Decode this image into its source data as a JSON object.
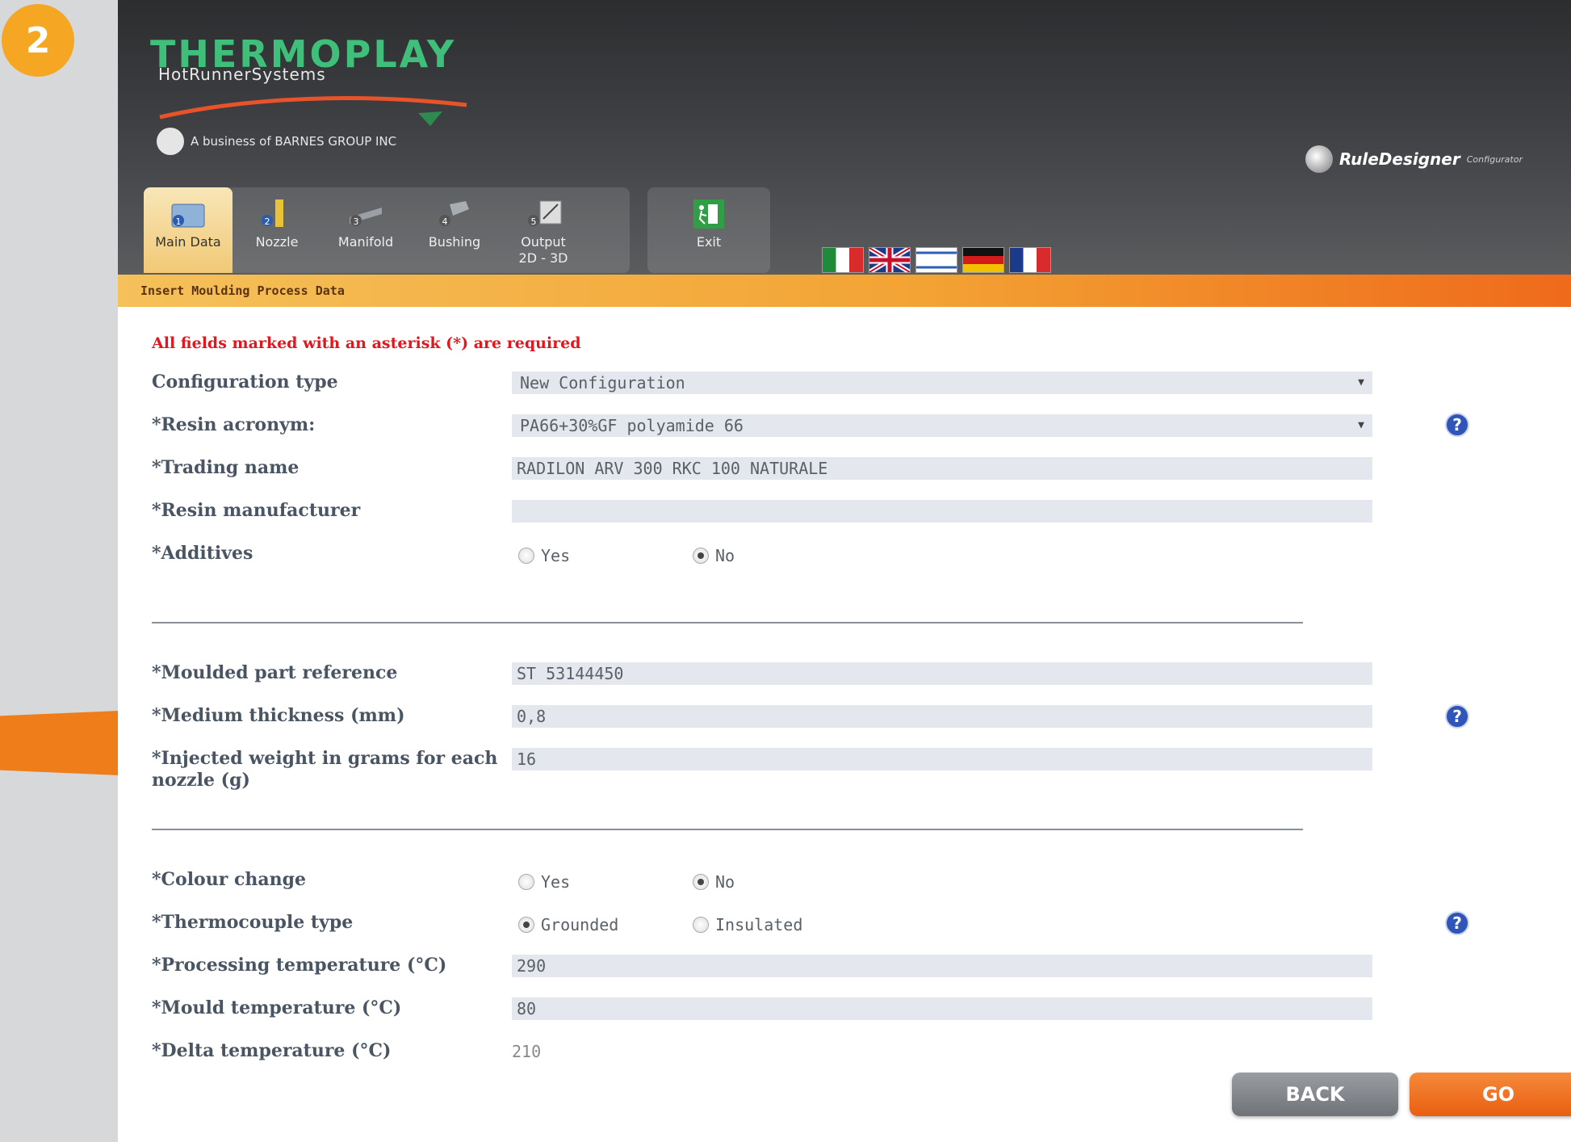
{
  "step_number": "2",
  "header": {
    "brand": "THERMOPLAY",
    "brand_sub": "HotRunnerSystems",
    "business_line": "A business of BARNES GROUP INC",
    "product": "RuleDesigner",
    "product_sub": "Configurator"
  },
  "tabs": [
    {
      "label": "Main Data",
      "number": "1",
      "icon": "main-data-icon"
    },
    {
      "label": "Nozzle",
      "number": "2",
      "icon": "nozzle-icon"
    },
    {
      "label": "Manifold",
      "number": "3",
      "icon": "manifold-icon"
    },
    {
      "label": "Bushing",
      "number": "4",
      "icon": "bushing-icon"
    },
    {
      "label": "Output\n2D - 3D",
      "number": "5",
      "icon": "output-icon"
    }
  ],
  "exit": {
    "label": "Exit",
    "icon": "exit-icon"
  },
  "flags": [
    "italy-flag",
    "uk-flag",
    "israel-flag",
    "germany-flag",
    "france-flag"
  ],
  "section_title": "Insert Moulding Process Data",
  "required_note": "All fields marked with an asterisk (*) are required",
  "form": {
    "configuration_type": {
      "label": "Configuration type",
      "value": "New Configuration"
    },
    "resin_acronym": {
      "label": "*Resin acronym:",
      "value": "PA66+30%GF polyamide 66"
    },
    "trading_name": {
      "label": "*Trading name",
      "value": "RADILON ARV 300 RKC 100 NATURALE"
    },
    "resin_manufacturer": {
      "label": "*Resin manufacturer",
      "value": ""
    },
    "additives": {
      "label": "*Additives",
      "options": [
        "Yes",
        "No"
      ],
      "selected": "No"
    },
    "moulded_part_reference": {
      "label": "*Moulded part reference",
      "value": "ST 53144450"
    },
    "medium_thickness": {
      "label": "*Medium thickness (mm)",
      "value": "0,8"
    },
    "injected_weight": {
      "label": "*Injected weight in grams for each nozzle (g)",
      "value": "16"
    },
    "colour_change": {
      "label": "*Colour change",
      "options": [
        "Yes",
        "No"
      ],
      "selected": "No"
    },
    "thermocouple_type": {
      "label": "*Thermocouple type",
      "options": [
        "Grounded",
        "Insulated"
      ],
      "selected": "Grounded"
    },
    "processing_temperature": {
      "label": "*Processing temperature (°C)",
      "value": "290"
    },
    "mould_temperature": {
      "label": "*Mould temperature (°C)",
      "value": "80"
    },
    "delta_temperature": {
      "label": "*Delta temperature (°C)",
      "value": "210"
    }
  },
  "buttons": {
    "back": "BACK",
    "go": "GO"
  },
  "colors": {
    "accent_orange": "#ef6a1b",
    "header_dark": "#3e4043",
    "brand_green": "#3fbf7a",
    "required_red": "#e4161d"
  }
}
